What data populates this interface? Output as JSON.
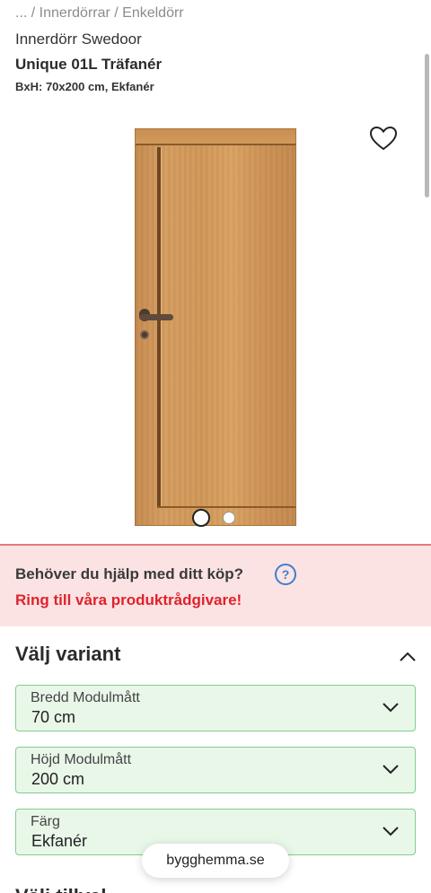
{
  "breadcrumb": "... / Innerdörrar / Enkeldörr",
  "product": {
    "brand": "Innerdörr Swedoor",
    "title": "Unique 01L Träfanér",
    "subtitle": "BxH: 70x200 cm, Ekfanér",
    "favorite_icon": "heart-outline-icon"
  },
  "gallery": {
    "image_count": 2,
    "active_index": 1
  },
  "help": {
    "question": "Behöver du hjälp med ditt köp?",
    "icon": "?",
    "call_text": "Ring till våra produktrådgivare!",
    "background_color": "#fbe3e3",
    "accent_color": "#e0222c"
  },
  "variant": {
    "title": "Välj variant",
    "options": [
      {
        "label": "Bredd Modulmått",
        "value": "70 cm"
      },
      {
        "label": "Höjd Modulmått",
        "value": "200 cm"
      },
      {
        "label": "Färg",
        "value": "Ekfanér"
      }
    ],
    "selected_border_color": "#7fcf8a",
    "selected_background_color": "#e9f7e9"
  },
  "site": {
    "domain": "bygghemma.se"
  },
  "next_section": {
    "heading": "Välj tillval"
  }
}
